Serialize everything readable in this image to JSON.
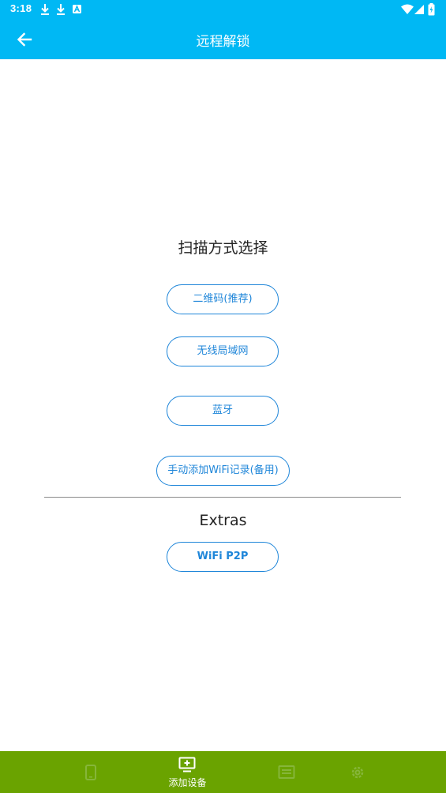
{
  "status_bar": {
    "time": "3:18",
    "left_icons": [
      "download-icon",
      "download-icon",
      "app-notification-icon"
    ],
    "right_icons": [
      "wifi-icon",
      "signal-icon",
      "battery-icon"
    ]
  },
  "app_bar": {
    "title": "远程解锁",
    "back_icon": "arrow-left-icon",
    "color": "#00b8f4"
  },
  "scan": {
    "title": "扫描方式选择",
    "options": [
      {
        "label": "二维码(推荐)"
      },
      {
        "label": "无线局域网"
      },
      {
        "label": "蓝牙"
      },
      {
        "label": "手动添加WiFi记录(备用)"
      }
    ]
  },
  "extras": {
    "title": "Extras",
    "options": [
      {
        "label": "WiFi P2P"
      }
    ]
  },
  "bottom_nav": {
    "color": "#6aa300",
    "items": [
      {
        "icon": "phone-icon",
        "label": "",
        "active": false
      },
      {
        "icon": "add-device-icon",
        "label": "添加设备",
        "active": true
      },
      {
        "icon": "list-icon",
        "label": "",
        "active": false
      },
      {
        "icon": "settings-icon",
        "label": "",
        "active": false
      }
    ]
  },
  "accent_color": "#1f86d9"
}
